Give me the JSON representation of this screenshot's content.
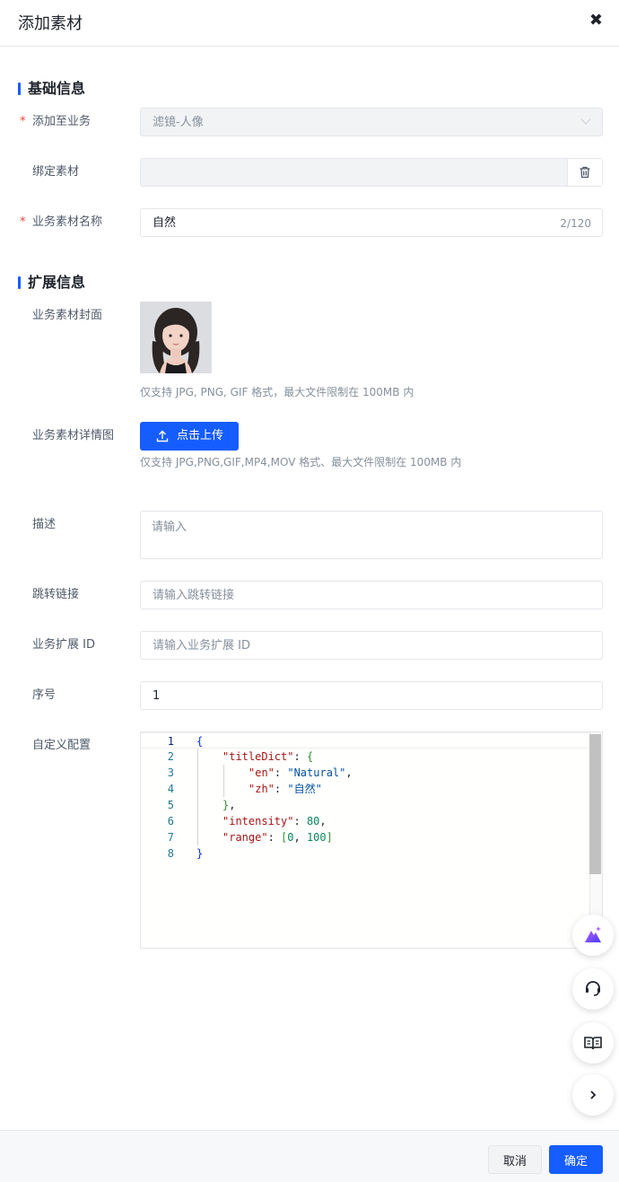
{
  "header": {
    "title": "添加素材",
    "close_glyph": "✖"
  },
  "sections": {
    "basic": "基础信息",
    "extended": "扩展信息"
  },
  "required_mark": "*",
  "basic": {
    "business": {
      "label": "添加至业务",
      "value": "滤镜-人像",
      "icon": "chevron-down-icon"
    },
    "bind": {
      "label": "绑定素材",
      "value": "",
      "icon": "trash-icon"
    },
    "name": {
      "label": "业务素材名称",
      "value": "自然",
      "count": "2/120"
    }
  },
  "extended": {
    "cover": {
      "label": "业务素材封面",
      "hint": "仅支持 JPG, PNG, GIF 格式，最大文件限制在 100MB 内"
    },
    "detail": {
      "label": "业务素材详情图",
      "button": "点击上传",
      "icon": "upload-icon",
      "hint": "仅支持 JPG,PNG,GIF,MP4,MOV 格式、最大文件限制在 100MB 内"
    },
    "desc": {
      "label": "描述",
      "placeholder": "请输入"
    },
    "link": {
      "label": "跳转链接",
      "placeholder": "请输入跳转链接"
    },
    "ext_id": {
      "label": "业务扩展 ID",
      "placeholder": "请输入业务扩展 ID"
    },
    "order": {
      "label": "序号",
      "value": "1"
    },
    "config": {
      "label": "自定义配置",
      "line_numbers": [
        "1",
        "2",
        "3",
        "4",
        "5",
        "6",
        "7",
        "8"
      ],
      "code": {
        "l1": "{",
        "l2_key": "\"titleDict\"",
        "l2_colon": ": ",
        "l2_brace": "{",
        "l3_key": "\"en\"",
        "l3_colon": ": ",
        "l3_val": "\"Natural\"",
        "l3_comma": ",",
        "l4_key": "\"zh\"",
        "l4_colon": ": ",
        "l4_val": "\"自然\"",
        "l5_brace": "}",
        "l5_comma": ",",
        "l6_key": "\"intensity\"",
        "l6_colon": ": ",
        "l6_val": "80",
        "l6_comma": ",",
        "l7_key": "\"range\"",
        "l7_colon": ": ",
        "l7_open": "[",
        "l7_a": "0",
        "l7_sep": ", ",
        "l7_b": "100",
        "l7_close": "]",
        "l8": "}"
      }
    }
  },
  "floating_buttons": [
    "ai-assistant-icon",
    "customer-service-icon",
    "docs-book-icon",
    "chevron-right-icon"
  ],
  "footer": {
    "cancel": "取消",
    "ok": "确定"
  },
  "colors": {
    "primary": "#165dff",
    "required": "#f53f3f",
    "border": "#e5e6eb"
  }
}
